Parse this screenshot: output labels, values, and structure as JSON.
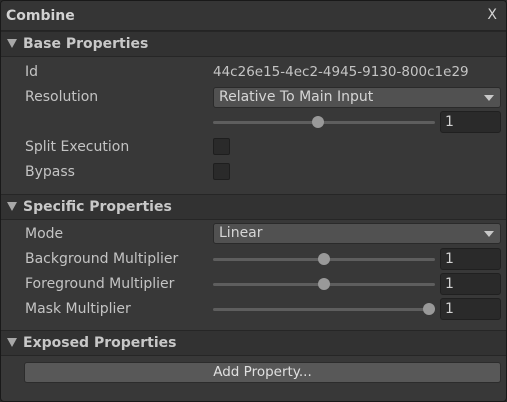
{
  "window": {
    "title": "Combine",
    "close_label": "X"
  },
  "base_properties": {
    "header": "Base Properties",
    "id_label": "Id",
    "id_value": "44c26e15-4ec2-4945-9130-800c1e29",
    "resolution_label": "Resolution",
    "resolution_value": "Relative To Main Input",
    "resolution_slider_fraction": 0.47,
    "resolution_number": "1",
    "split_execution_label": "Split Execution",
    "split_execution_checked": false,
    "bypass_label": "Bypass",
    "bypass_checked": false
  },
  "specific_properties": {
    "header": "Specific Properties",
    "mode_label": "Mode",
    "mode_value": "Linear",
    "background_multiplier_label": "Background Multiplier",
    "background_multiplier_fraction": 0.5,
    "background_multiplier_value": "1",
    "foreground_multiplier_label": "Foreground Multiplier",
    "foreground_multiplier_fraction": 0.5,
    "foreground_multiplier_value": "1",
    "mask_multiplier_label": "Mask Multiplier",
    "mask_multiplier_fraction": 1.0,
    "mask_multiplier_value": "1"
  },
  "exposed_properties": {
    "header": "Exposed Properties",
    "add_property_label": "Add Property..."
  },
  "icons": {
    "collapse": "triangle-down-icon",
    "dropdown": "chevron-down-icon"
  },
  "colors": {
    "panel_background": "#383838",
    "header_background": "#323232",
    "field_background": "#2a2a2a",
    "dropdown_background": "#515151",
    "button_background": "#585858",
    "text": "#c4c4c4"
  }
}
